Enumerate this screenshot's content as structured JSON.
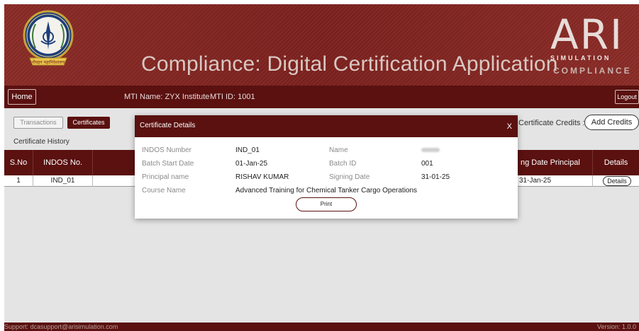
{
  "header": {
    "title": "Compliance: Digital Certification Application",
    "brand_mark": "ARI",
    "brand_line1": "SIMULATION",
    "brand_line2": "COMPLIANCE",
    "emblem_text": "नौवहन महानिदेशालय"
  },
  "nav": {
    "home_label": "Home",
    "mti_name": "MTI Name: ZYX Institute",
    "mti_id": "MTI ID: 1001",
    "logout_label": "Logout"
  },
  "tabs": {
    "transactions": "Transactions",
    "certificates": "Certificates"
  },
  "section_title": "Certificate History",
  "credits": {
    "label": "Certificate Credits : 0",
    "add_label": "Add Credits"
  },
  "table": {
    "headers": {
      "sno": "S.No",
      "indos": "INDOS No.",
      "signing_date": "ng Date Principal",
      "details": "Details"
    },
    "rows": [
      {
        "sno": "1",
        "indos": "IND_01",
        "signing_date": "31-Jan-25",
        "details_label": "Details"
      }
    ]
  },
  "modal": {
    "title": "Certificate Details",
    "close": "X",
    "fields": {
      "indos_label": "INDOS Number",
      "indos_value": "IND_01",
      "name_label": "Name",
      "batch_start_label": "Batch Start Date",
      "batch_start_value": "01-Jan-25",
      "batch_id_label": "Batch ID",
      "batch_id_value": "001",
      "principal_label": "Principal name",
      "principal_value": "RISHAV KUMAR",
      "signing_label": "Signing Date",
      "signing_value": "31-01-25",
      "course_label": "Course Name",
      "course_value": "Advanced Training for Chemical Tanker Cargo Operations"
    },
    "print_label": "Print"
  },
  "footer": {
    "support": "Support: dcasupport@arisimulation.com",
    "version": "Version: 1.0.0"
  },
  "colors": {
    "primary": "#5a1110",
    "header_bg": "#7a1f1c",
    "content_bg": "#e4e4e4"
  }
}
